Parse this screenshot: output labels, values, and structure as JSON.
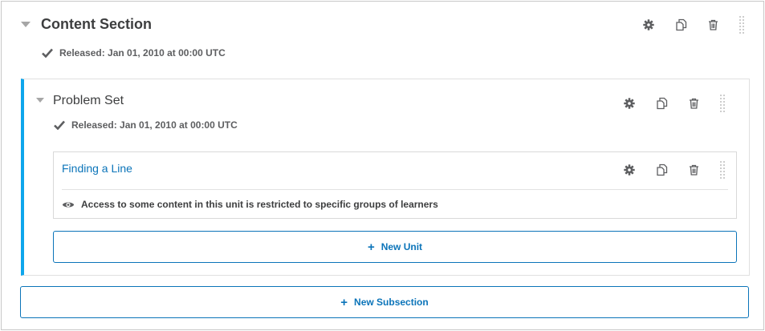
{
  "section": {
    "title": "Content Section",
    "release": "Released: Jan 01, 2010 at 00:00 UTC",
    "icons": [
      "caret-down-icon",
      "check-icon",
      "gear-icon",
      "duplicate-icon",
      "trash-icon",
      "drag-handle-icon"
    ]
  },
  "subsection": {
    "title": "Problem Set",
    "release": "Released: Jan 01, 2010 at 00:00 UTC",
    "accent_color": "#0ea6ec"
  },
  "unit": {
    "title": "Finding a Line",
    "restriction": "Access to some content in this unit is restricted to specific groups of learners",
    "restriction_icon": "eye-icon"
  },
  "buttons": {
    "new_unit": "New Unit",
    "new_subsection": "New Subsection",
    "accent_color": "#0b74b9"
  }
}
